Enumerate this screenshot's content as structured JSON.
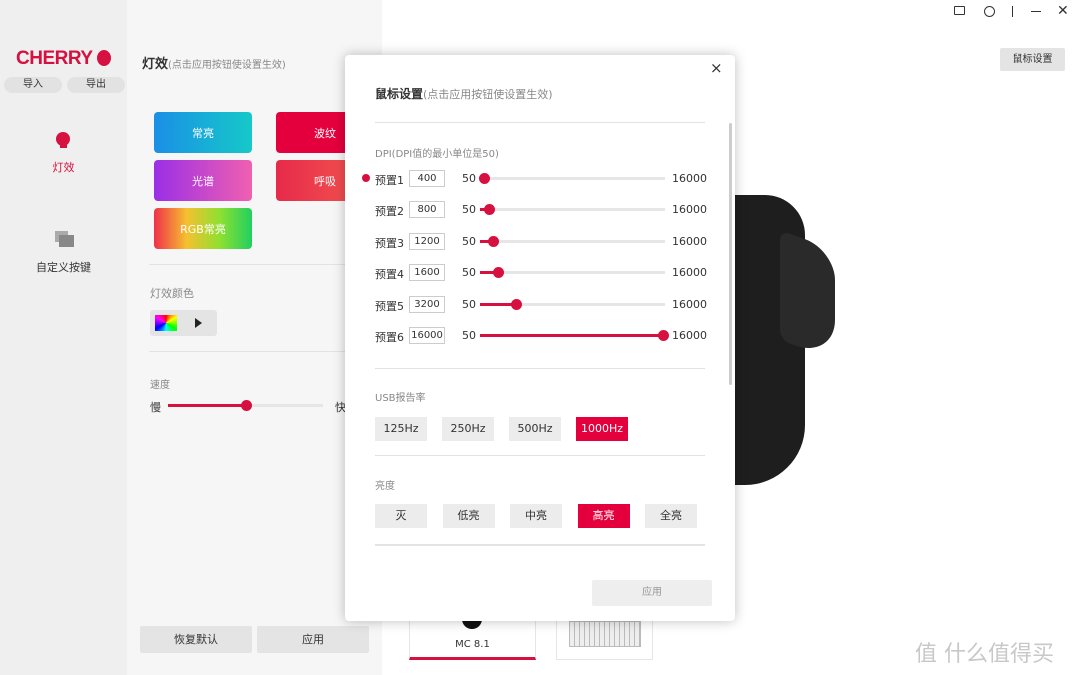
{
  "sidebar": {
    "logo": "CHERRY",
    "import": "导入",
    "export": "导出",
    "nav": [
      {
        "label": "灯效",
        "icon": "lightbulb-icon",
        "active": true
      },
      {
        "label": "自定义按键",
        "icon": "layers-icon",
        "active": false
      }
    ]
  },
  "panel": {
    "title": "灯效",
    "hint": "(点击应用按钮使设置生效)",
    "effects": [
      "常亮",
      "波纹",
      "光谱",
      "呼吸",
      "RGB常亮"
    ],
    "color_label": "灯效颜色",
    "speed_label": "速度",
    "slow": "慢",
    "fast": "快",
    "speed_value": 0.5,
    "reset": "恢复默认",
    "apply": "应用"
  },
  "topbar": {
    "icons": [
      "feedback-icon",
      "target-icon",
      "minimize-icon",
      "close-icon"
    ],
    "mouse_settings": "鼠标设置"
  },
  "devices": [
    {
      "label": "MC 8.1",
      "selected": true
    },
    {
      "label": "",
      "selected": false
    }
  ],
  "watermark": "值 什么值得买",
  "modal": {
    "title": "鼠标设置",
    "hint": "(点击应用按钮使设置生效)",
    "dpi_label": "DPI(DPI值的最小单位是50)",
    "min": "50",
    "max": "16000",
    "presets": [
      {
        "label": "预置1",
        "value": "400",
        "active": true
      },
      {
        "label": "预置2",
        "value": "800"
      },
      {
        "label": "预置3",
        "value": "1200"
      },
      {
        "label": "预置4",
        "value": "1600"
      },
      {
        "label": "预置5",
        "value": "3200"
      },
      {
        "label": "预置6",
        "value": "16000"
      }
    ],
    "usb_label": "USB报告率",
    "usb": [
      "125Hz",
      "250Hz",
      "500Hz",
      "1000Hz"
    ],
    "usb_selected": 3,
    "brightness_label": "亮度",
    "brightness": [
      "灭",
      "低亮",
      "中亮",
      "高亮",
      "全亮"
    ],
    "brightness_selected": 3,
    "apply": "应用"
  },
  "colors": {
    "accent": "#d6103f"
  }
}
